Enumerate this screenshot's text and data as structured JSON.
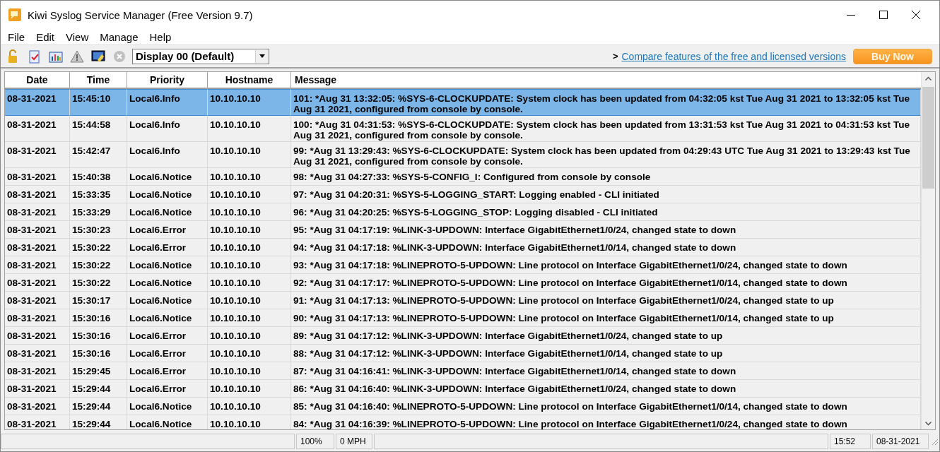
{
  "window": {
    "title": "Kiwi Syslog Service Manager (Free Version 9.7)"
  },
  "menu": [
    "File",
    "Edit",
    "View",
    "Manage",
    "Help"
  ],
  "toolbar": {
    "display": "Display 00 (Default)",
    "link_arrow": ">",
    "link": "Compare features of the free and licensed versions",
    "buy_button": "Buy Now"
  },
  "table": {
    "columns": [
      "Date",
      "Time",
      "Priority",
      "Hostname",
      "Message"
    ],
    "rows": [
      {
        "selected": true,
        "cells": [
          "08-31-2021",
          "15:45:10",
          "Local6.Info",
          "10.10.10.10",
          "101: *Aug 31 13:32:05: %SYS-6-CLOCKUPDATE: System clock has been updated from 04:32:05 kst Tue Aug 31 2021 to 13:32:05 kst Tue Aug 31 2021, configured from console by console."
        ]
      },
      {
        "selected": false,
        "cells": [
          "08-31-2021",
          "15:44:58",
          "Local6.Info",
          "10.10.10.10",
          "100: *Aug 31 04:31:53: %SYS-6-CLOCKUPDATE: System clock has been updated from 13:31:53 kst Tue Aug 31 2021 to 04:31:53 kst Tue Aug 31 2021, configured from console by console."
        ]
      },
      {
        "selected": false,
        "cells": [
          "08-31-2021",
          "15:42:47",
          "Local6.Info",
          "10.10.10.10",
          "99: *Aug 31 13:29:43: %SYS-6-CLOCKUPDATE: System clock has been updated from 04:29:43 UTC Tue Aug 31 2021 to 13:29:43 kst Tue Aug 31 2021, configured from console by console."
        ]
      },
      {
        "selected": false,
        "cells": [
          "08-31-2021",
          "15:40:38",
          "Local6.Notice",
          "10.10.10.10",
          "98: *Aug 31 04:27:33: %SYS-5-CONFIG_I: Configured from console by console"
        ]
      },
      {
        "selected": false,
        "cells": [
          "08-31-2021",
          "15:33:35",
          "Local6.Notice",
          "10.10.10.10",
          "97: *Aug 31 04:20:31: %SYS-5-LOGGING_START: Logging enabled - CLI initiated"
        ]
      },
      {
        "selected": false,
        "cells": [
          "08-31-2021",
          "15:33:29",
          "Local6.Notice",
          "10.10.10.10",
          "96: *Aug 31 04:20:25: %SYS-5-LOGGING_STOP: Logging disabled - CLI initiated"
        ]
      },
      {
        "selected": false,
        "cells": [
          "08-31-2021",
          "15:30:23",
          "Local6.Error",
          "10.10.10.10",
          "95: *Aug 31 04:17:19: %LINK-3-UPDOWN: Interface GigabitEthernet1/0/24, changed state to down"
        ]
      },
      {
        "selected": false,
        "cells": [
          "08-31-2021",
          "15:30:22",
          "Local6.Error",
          "10.10.10.10",
          "94: *Aug 31 04:17:18: %LINK-3-UPDOWN: Interface GigabitEthernet1/0/14, changed state to down"
        ]
      },
      {
        "selected": false,
        "cells": [
          "08-31-2021",
          "15:30:22",
          "Local6.Notice",
          "10.10.10.10",
          "93: *Aug 31 04:17:18: %LINEPROTO-5-UPDOWN: Line protocol on Interface GigabitEthernet1/0/24, changed state to down"
        ]
      },
      {
        "selected": false,
        "cells": [
          "08-31-2021",
          "15:30:22",
          "Local6.Notice",
          "10.10.10.10",
          "92: *Aug 31 04:17:17: %LINEPROTO-5-UPDOWN: Line protocol on Interface GigabitEthernet1/0/14, changed state to down"
        ]
      },
      {
        "selected": false,
        "cells": [
          "08-31-2021",
          "15:30:17",
          "Local6.Notice",
          "10.10.10.10",
          "91: *Aug 31 04:17:13: %LINEPROTO-5-UPDOWN: Line protocol on Interface GigabitEthernet1/0/24, changed state to up"
        ]
      },
      {
        "selected": false,
        "cells": [
          "08-31-2021",
          "15:30:16",
          "Local6.Notice",
          "10.10.10.10",
          "90: *Aug 31 04:17:13: %LINEPROTO-5-UPDOWN: Line protocol on Interface GigabitEthernet1/0/14, changed state to up"
        ]
      },
      {
        "selected": false,
        "cells": [
          "08-31-2021",
          "15:30:16",
          "Local6.Error",
          "10.10.10.10",
          "89: *Aug 31 04:17:12: %LINK-3-UPDOWN: Interface GigabitEthernet1/0/24, changed state to up"
        ]
      },
      {
        "selected": false,
        "cells": [
          "08-31-2021",
          "15:30:16",
          "Local6.Error",
          "10.10.10.10",
          "88: *Aug 31 04:17:12: %LINK-3-UPDOWN: Interface GigabitEthernet1/0/14, changed state to up"
        ]
      },
      {
        "selected": false,
        "cells": [
          "08-31-2021",
          "15:29:45",
          "Local6.Error",
          "10.10.10.10",
          "87: *Aug 31 04:16:41: %LINK-3-UPDOWN: Interface GigabitEthernet1/0/14, changed state to down"
        ]
      },
      {
        "selected": false,
        "cells": [
          "08-31-2021",
          "15:29:44",
          "Local6.Error",
          "10.10.10.10",
          "86: *Aug 31 04:16:40: %LINK-3-UPDOWN: Interface GigabitEthernet1/0/24, changed state to down"
        ]
      },
      {
        "selected": false,
        "cells": [
          "08-31-2021",
          "15:29:44",
          "Local6.Notice",
          "10.10.10.10",
          "85: *Aug 31 04:16:40: %LINEPROTO-5-UPDOWN: Line protocol on Interface GigabitEthernet1/0/14, changed state to down"
        ]
      },
      {
        "selected": false,
        "cells": [
          "08-31-2021",
          "15:29:44",
          "Local6.Notice",
          "10.10.10.10",
          "84: *Aug 31 04:16:39: %LINEPROTO-5-UPDOWN: Line protocol on Interface GigabitEthernet1/0/24, changed state to down"
        ]
      }
    ]
  },
  "status_bar": {
    "zoom": "100%",
    "rate": "0 MPH",
    "time": "15:52",
    "date": "08-31-2021"
  }
}
